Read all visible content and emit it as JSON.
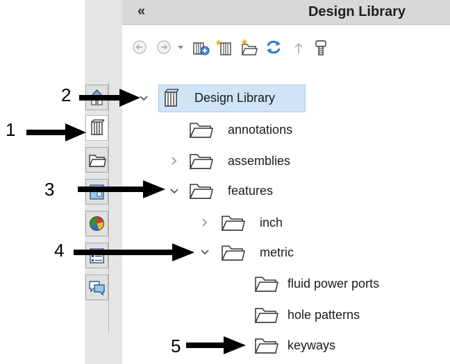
{
  "header": {
    "collapse_glyph": "«",
    "title": "Design Library"
  },
  "toolbar": {
    "buttons": [
      {
        "name": "back-icon"
      },
      {
        "name": "forward-icon"
      },
      {
        "name": "dropdown-icon"
      },
      {
        "name": "add-to-library-icon"
      },
      {
        "name": "add-file-location-icon"
      },
      {
        "name": "create-new-folder-icon"
      },
      {
        "name": "refresh-icon"
      },
      {
        "name": "up-one-level-icon"
      },
      {
        "name": "toolbox-icon"
      }
    ]
  },
  "side_tabs": [
    {
      "name": "home-tab",
      "active": false
    },
    {
      "name": "design-library-tab",
      "active": true
    },
    {
      "name": "file-explorer-tab",
      "active": false
    },
    {
      "name": "view-palette-tab",
      "active": false
    },
    {
      "name": "appearances-tab",
      "active": false
    },
    {
      "name": "custom-properties-tab",
      "active": false
    },
    {
      "name": "forum-tab",
      "active": false
    }
  ],
  "tree": {
    "root": {
      "label": "Design Library",
      "expanded": true,
      "selected": true
    },
    "items": [
      {
        "label": "annotations",
        "level": 1,
        "expander": "none"
      },
      {
        "label": "assemblies",
        "level": 1,
        "expander": "collapsed"
      },
      {
        "label": "features",
        "level": 1,
        "expander": "expanded"
      },
      {
        "label": "inch",
        "level": 2,
        "expander": "collapsed"
      },
      {
        "label": "metric",
        "level": 2,
        "expander": "expanded"
      },
      {
        "label": "fluid power ports",
        "level": 3,
        "expander": "none"
      },
      {
        "label": "hole patterns",
        "level": 3,
        "expander": "none"
      },
      {
        "label": "keyways",
        "level": 3,
        "expander": "none"
      }
    ]
  },
  "callouts": [
    "1",
    "2",
    "3",
    "4",
    "5"
  ],
  "colors": {
    "selection": "#cfe4f7",
    "header": "#d8d8d8",
    "strip": "#e6e6e6"
  }
}
